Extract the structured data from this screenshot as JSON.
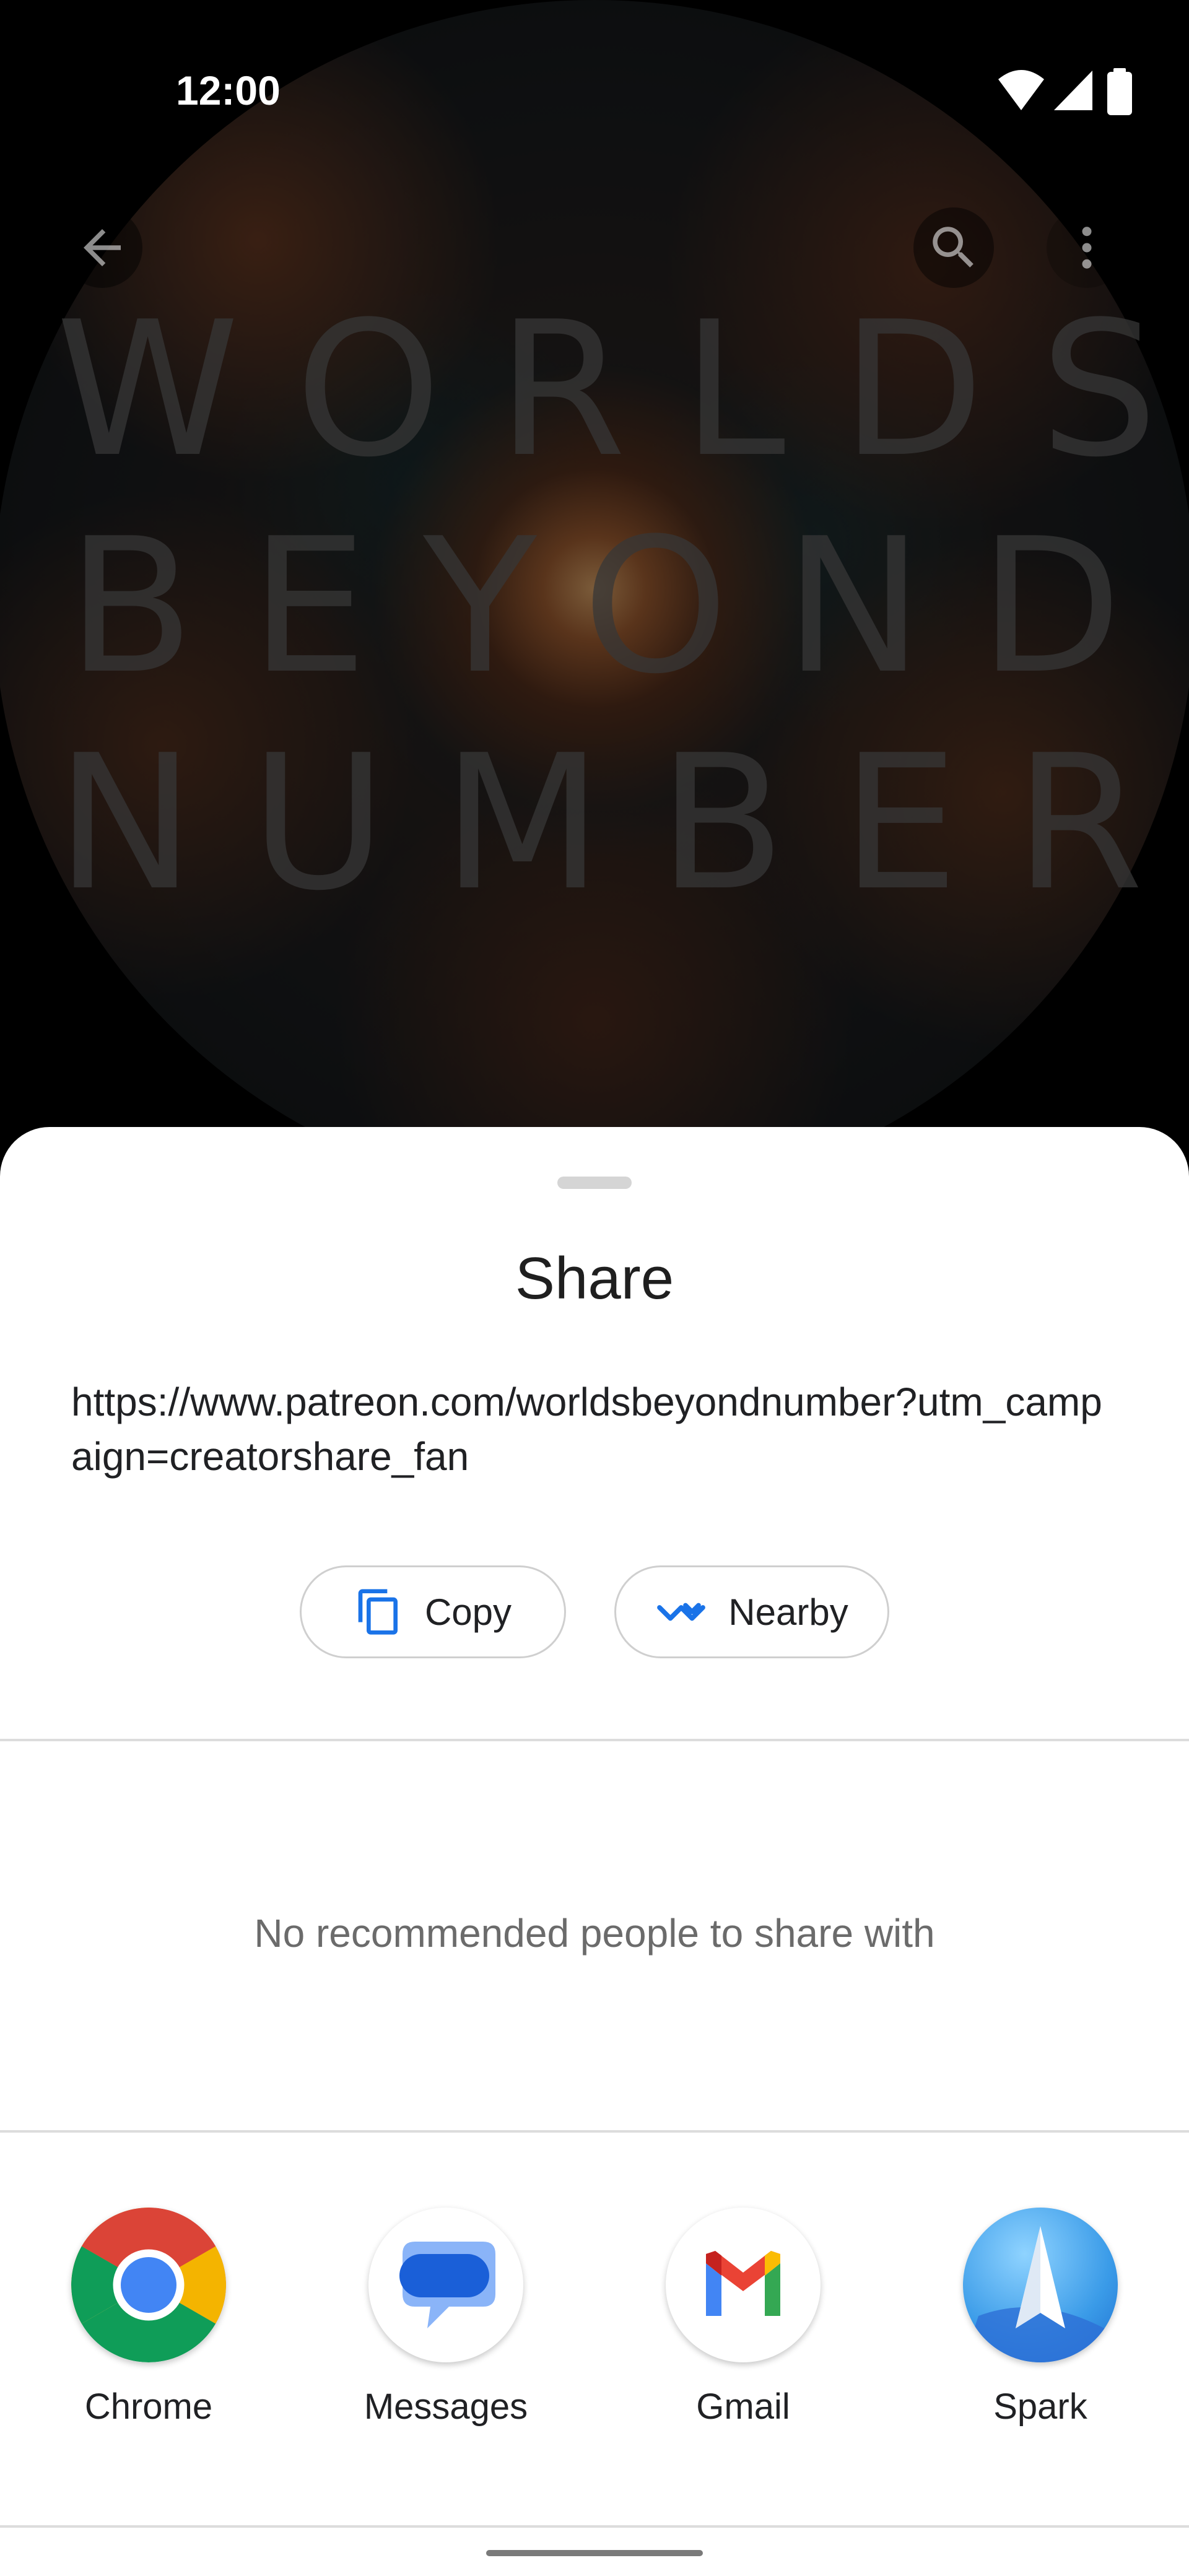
{
  "status_bar": {
    "time": "12:00",
    "icons": [
      "wifi-icon",
      "cellular-signal-icon",
      "battery-icon"
    ]
  },
  "background": {
    "art_title_lines": [
      "WORLDS",
      "BEYOND",
      "NUMBER"
    ],
    "top_bar_icons": [
      "back-arrow-icon",
      "search-icon",
      "more-vert-icon"
    ]
  },
  "share_sheet": {
    "title": "Share",
    "url": "https://www.patreon.com/worldsbeyondnumber?utm_campaign=creatorshare_fan",
    "actions": [
      {
        "label": "Copy",
        "icon": "copy-icon"
      },
      {
        "label": "Nearby",
        "icon": "nearby-share-icon"
      }
    ],
    "empty_people_text": "No recommended people to share with",
    "apps": [
      {
        "label": "Chrome",
        "icon": "chrome-icon"
      },
      {
        "label": "Messages",
        "icon": "messages-icon"
      },
      {
        "label": "Gmail",
        "icon": "gmail-icon"
      },
      {
        "label": "Spark",
        "icon": "spark-icon"
      }
    ]
  },
  "colors": {
    "sheet_background": "#ffffff",
    "accent_blue": "#1a73e8",
    "divider": "#dcdcdc"
  }
}
